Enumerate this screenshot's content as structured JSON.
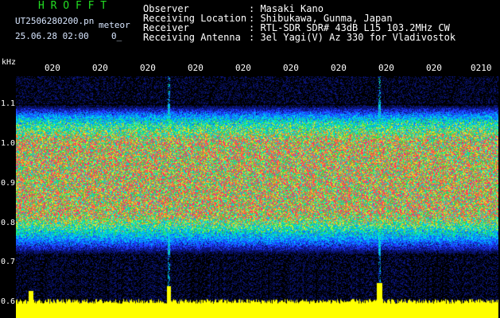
{
  "header": {
    "title": "H R O F F T",
    "filename": "UT2506280200.pn",
    "label": "meteor",
    "datetime": "25.06.28 02:00",
    "count": "0_"
  },
  "meta": {
    "observer_label": "Observer",
    "observer_value": ": Masaki Kano",
    "location_label": "Receiving Location",
    "location_value": ": Shibukawa, Gunma, Japan",
    "receiver_label": "Receiver",
    "receiver_value": ": RTL-SDR SDR# 43dB L15 103.2MHz CW",
    "antenna_label": "Receiving Antenna",
    "antenna_value": ": 3el Yagi(V) Az 330 for Vladivostok"
  },
  "axis": {
    "unit": "kHz",
    "y_ticks": [
      "1.1",
      "1.0",
      "0.9",
      "0.8",
      "0.7",
      "0.6"
    ],
    "x_ticks": [
      "020",
      "020",
      "020",
      "020",
      "020",
      "020",
      "020",
      "020",
      "020",
      "0210"
    ]
  },
  "colors": {
    "background": "#000000",
    "signal_core": "#ff2070",
    "signal_edge": "#00c8ff",
    "noise": "#2040ff",
    "level": "#ffff00",
    "title": "#22dd22"
  }
}
